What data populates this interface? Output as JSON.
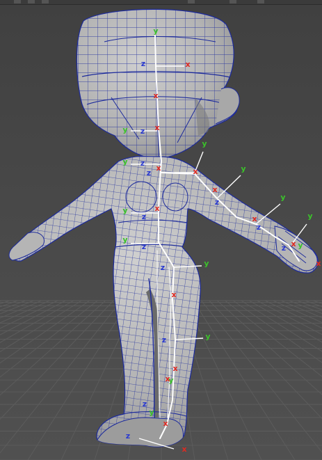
{
  "viewport": {
    "background": "#4a4a4a",
    "grid_color": "#5c5c5c",
    "mesh_fill": "#b9b9b9",
    "wire_color": "#1c2a9c",
    "bone_color": "#ffffff"
  },
  "axis_colors": {
    "x": "#e02a22",
    "y": "#3bc22a",
    "z": "#2a3ad0"
  },
  "axis_letters": {
    "x": "x",
    "y": "y",
    "z": "z"
  },
  "joints": [
    {
      "name": "head-top",
      "labels": [
        "y"
      ]
    },
    {
      "name": "head",
      "labels": [
        "z",
        "x"
      ]
    },
    {
      "name": "neck",
      "labels": [
        "x"
      ]
    },
    {
      "name": "neck-base",
      "labels": [
        "y",
        "z",
        "x"
      ]
    },
    {
      "name": "chest",
      "labels": [
        "y",
        "z",
        "x"
      ]
    },
    {
      "name": "shoulder",
      "labels": [
        "z",
        "x",
        "y"
      ]
    },
    {
      "name": "elbow",
      "labels": [
        "x",
        "y",
        "z"
      ]
    },
    {
      "name": "forearm",
      "labels": [
        "x",
        "y",
        "z"
      ]
    },
    {
      "name": "wrist",
      "labels": [
        "x",
        "y",
        "z"
      ]
    },
    {
      "name": "hand",
      "labels": [
        "x",
        "y"
      ]
    },
    {
      "name": "spine",
      "labels": [
        "y",
        "z",
        "x"
      ]
    },
    {
      "name": "hips",
      "labels": [
        "y",
        "z"
      ]
    },
    {
      "name": "hip-r",
      "labels": [
        "z",
        "y"
      ]
    },
    {
      "name": "thigh",
      "labels": [
        "x"
      ]
    },
    {
      "name": "knee",
      "labels": [
        "z",
        "y"
      ]
    },
    {
      "name": "shin",
      "labels": [
        "x"
      ]
    },
    {
      "name": "ankle",
      "labels": [
        "y",
        "x"
      ]
    },
    {
      "name": "foot",
      "labels": [
        "z",
        "y",
        "x"
      ]
    },
    {
      "name": "toe",
      "labels": [
        "z",
        "x"
      ]
    }
  ]
}
